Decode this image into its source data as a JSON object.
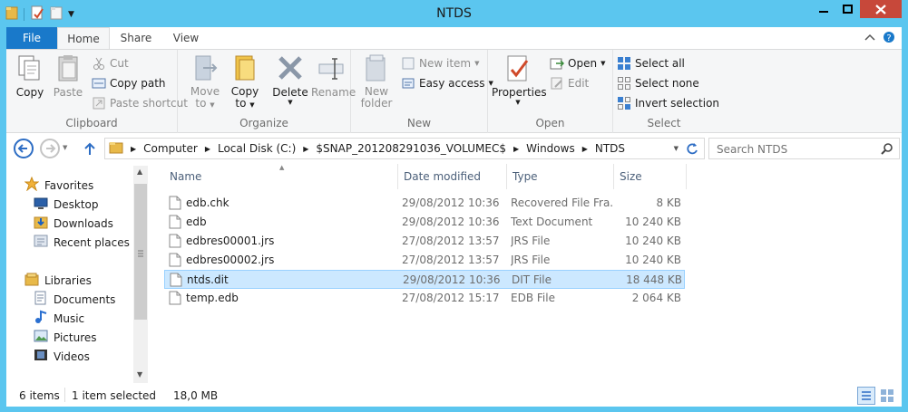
{
  "window": {
    "title": "NTDS"
  },
  "ribbon_tabs": [
    "File",
    "Home",
    "Share",
    "View"
  ],
  "ribbon": {
    "clipboard": {
      "label": "Clipboard",
      "copy": "Copy",
      "paste": "Paste",
      "cut": "Cut",
      "copy_path": "Copy path",
      "paste_shortcut": "Paste shortcut"
    },
    "organize": {
      "label": "Organize",
      "move_to_1": "Move",
      "move_to_2": "to",
      "copy_to_1": "Copy",
      "copy_to_2": "to",
      "delete": "Delete",
      "rename": "Rename"
    },
    "new": {
      "label": "New",
      "new_folder_1": "New",
      "new_folder_2": "folder",
      "new_item": "New item",
      "easy_access": "Easy access"
    },
    "open": {
      "label": "Open",
      "properties": "Properties",
      "open": "Open",
      "edit": "Edit"
    },
    "select": {
      "label": "Select",
      "select_all": "Select all",
      "select_none": "Select none",
      "invert_selection": "Invert selection"
    }
  },
  "address": {
    "crumbs": [
      "Computer",
      "Local Disk (C:)",
      "$SNAP_201208291036_VOLUMEC$",
      "Windows",
      "NTDS"
    ],
    "search_placeholder": "Search NTDS"
  },
  "nav": {
    "favorites": "Favorites",
    "favorite_items": [
      "Desktop",
      "Downloads",
      "Recent places"
    ],
    "libraries": "Libraries",
    "library_items": [
      "Documents",
      "Music",
      "Pictures",
      "Videos"
    ]
  },
  "columns": [
    "Name",
    "Date modified",
    "Type",
    "Size"
  ],
  "files": [
    {
      "name": "edb.chk",
      "date": "29/08/2012 10:36",
      "type": "Recovered File Fra...",
      "size": "8 KB",
      "selected": false
    },
    {
      "name": "edb",
      "date": "29/08/2012 10:36",
      "type": "Text Document",
      "size": "10 240 KB",
      "selected": false
    },
    {
      "name": "edbres00001.jrs",
      "date": "27/08/2012 13:57",
      "type": "JRS File",
      "size": "10 240 KB",
      "selected": false
    },
    {
      "name": "edbres00002.jrs",
      "date": "27/08/2012 13:57",
      "type": "JRS File",
      "size": "10 240 KB",
      "selected": false
    },
    {
      "name": "ntds.dit",
      "date": "29/08/2012 10:36",
      "type": "DIT File",
      "size": "18 448 KB",
      "selected": true
    },
    {
      "name": "temp.edb",
      "date": "27/08/2012 15:17",
      "type": "EDB File",
      "size": "2 064 KB",
      "selected": false
    }
  ],
  "status": {
    "count": "6 items",
    "selection": "1 item selected",
    "size": "18,0 MB"
  },
  "colors": {
    "title_bar": "#5bc6ef",
    "file_tab": "#1979ca",
    "close_button": "#c7483a",
    "selection": "#cce8ff"
  }
}
